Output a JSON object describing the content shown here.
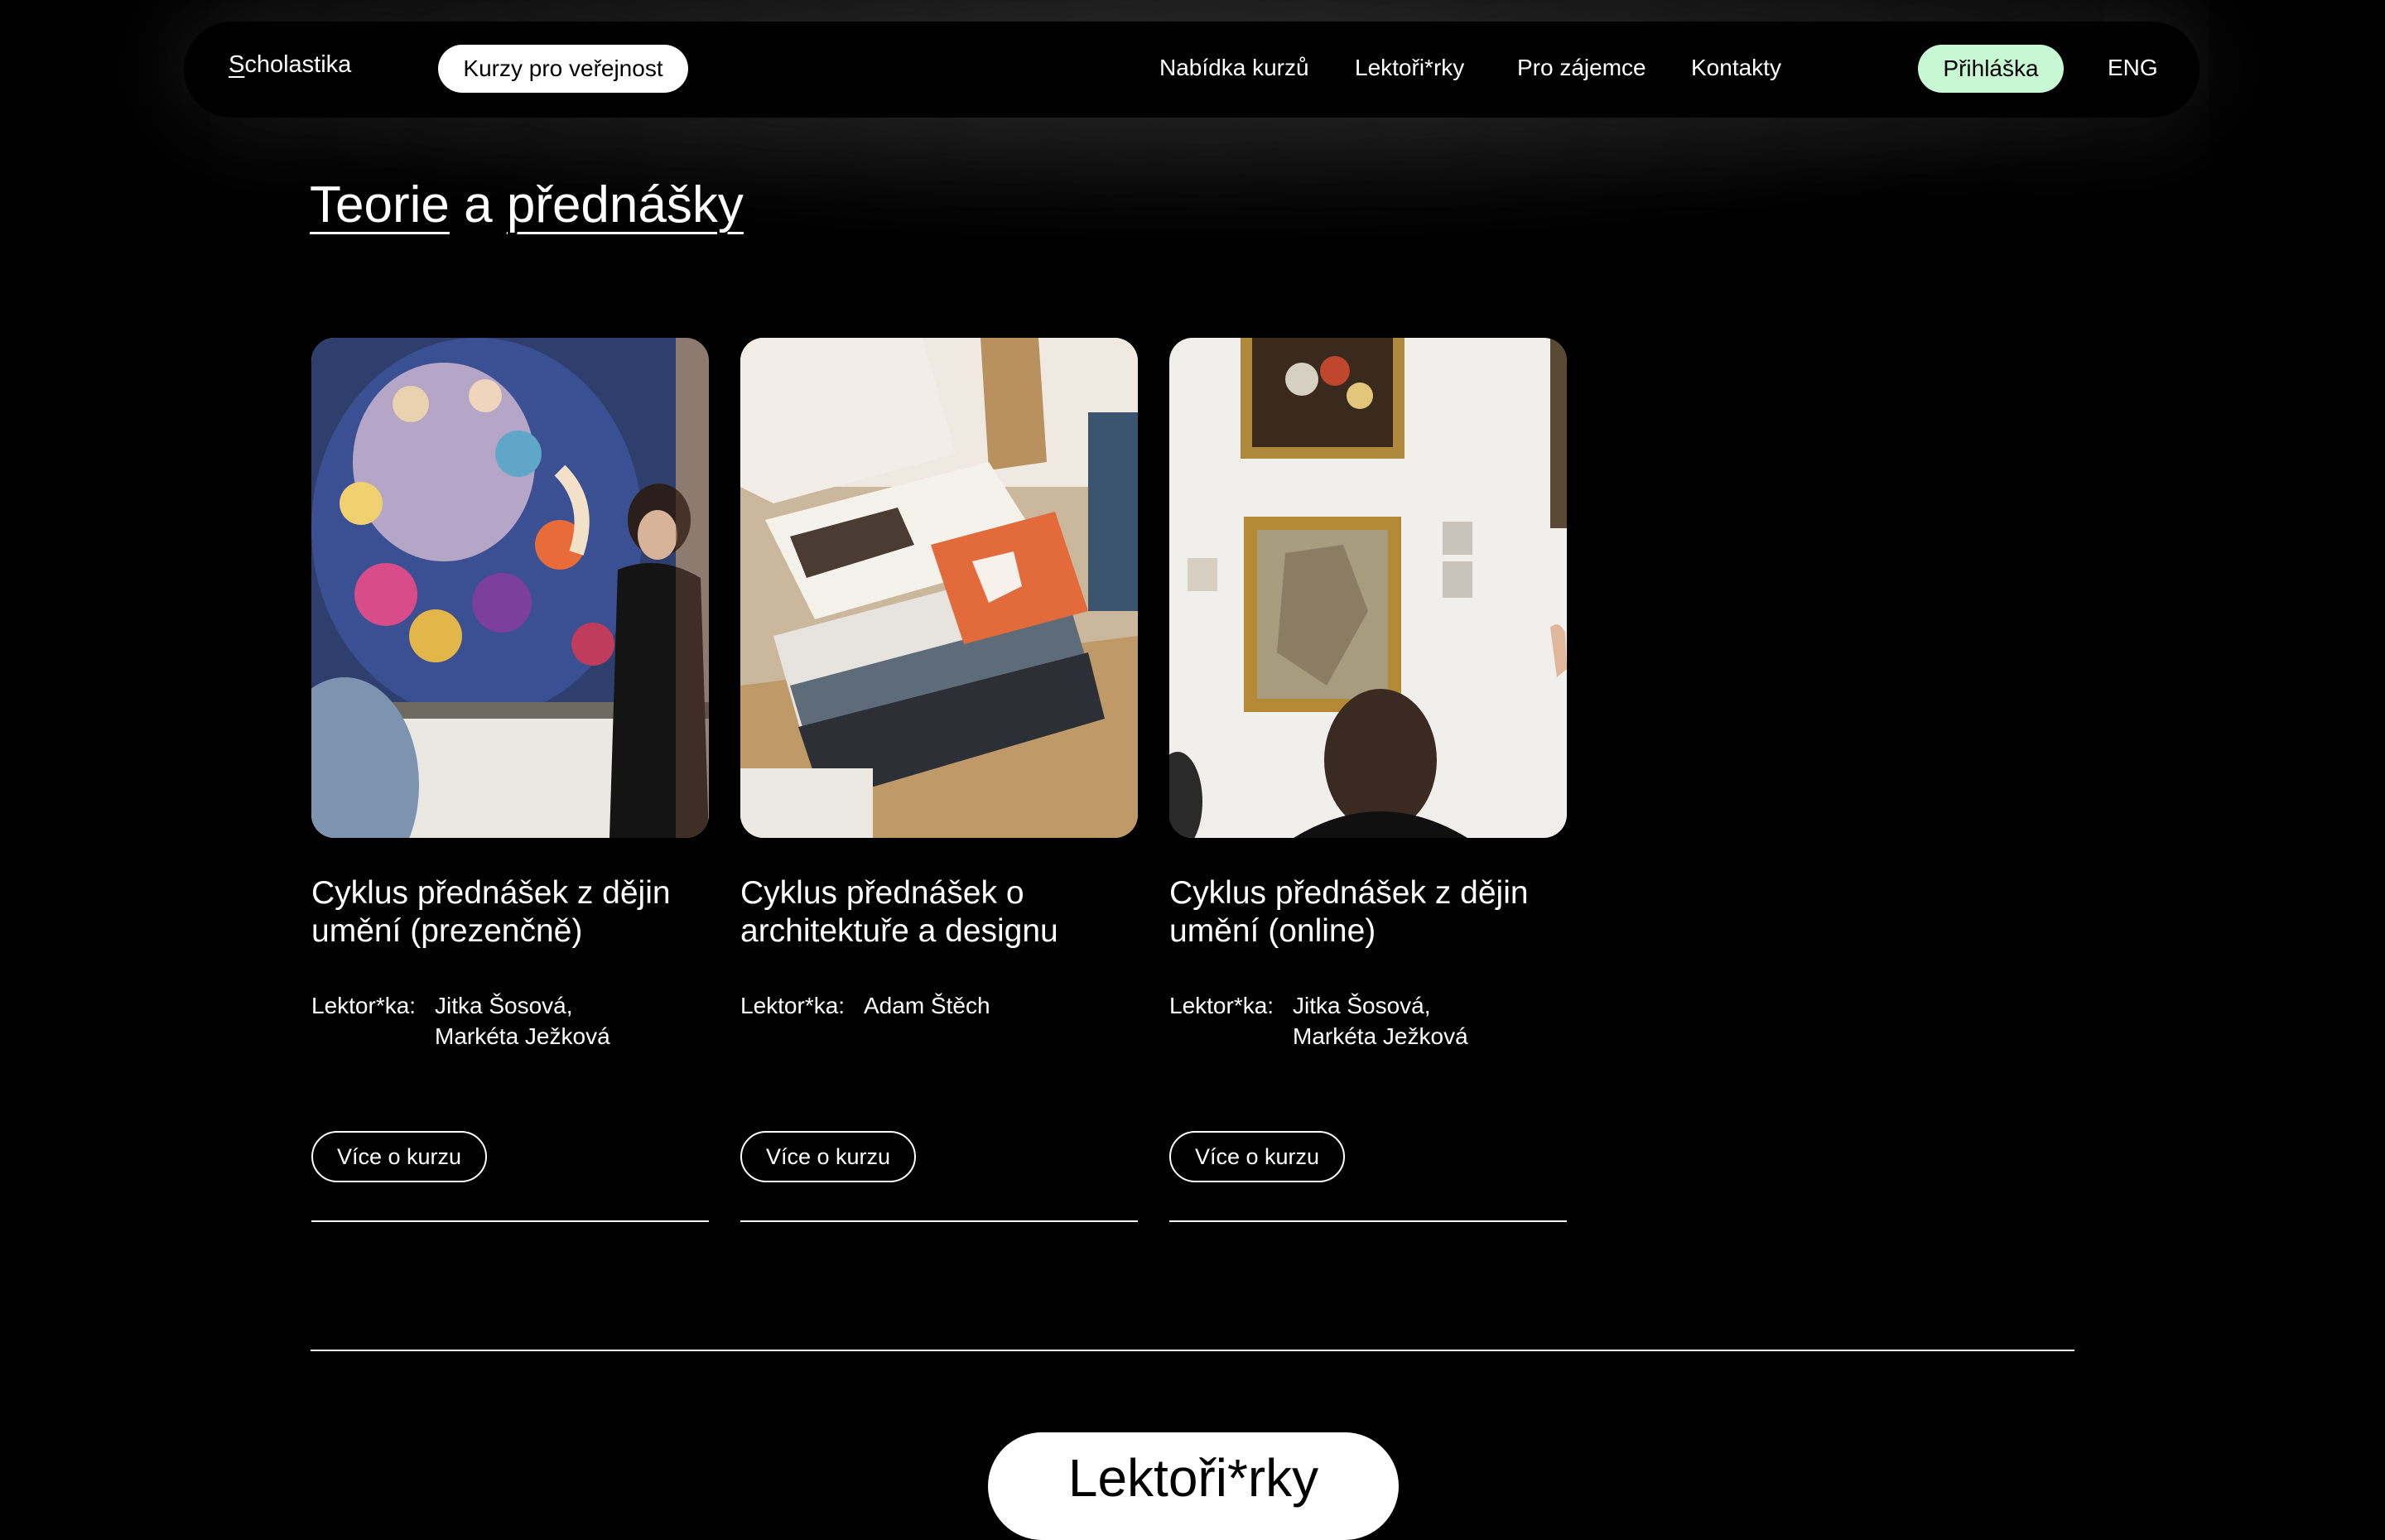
{
  "nav": {
    "brand_initial": "S",
    "brand_rest": "cholastika",
    "public_courses": "Kurzy pro veřejnost",
    "menu": [
      "Nabídka kurzů",
      "Lektoři*rky",
      "Pro zájemce",
      "Kontakty"
    ],
    "apply": "Přihláška",
    "lang": "ENG"
  },
  "section": {
    "title_word1": "Teorie",
    "title_mid": " a ",
    "title_word2": "přednášky"
  },
  "cards": [
    {
      "title": "Cyklus přednášek z dějin umění (prezenčně)",
      "lector_label": "Lektor*ka:",
      "lectors": [
        "Jitka Šosová,",
        "Markéta Ježková"
      ],
      "button": "Více o kurzu",
      "image": "gallery-painting-klimt-lecture"
    },
    {
      "title": "Cyklus přednášek o architektuře a designu",
      "lector_label": "Lektor*ka:",
      "lectors": [
        "Adam Štěch"
      ],
      "button": "Více o kurzu",
      "image": "stack-of-design-books"
    },
    {
      "title": "Cyklus přednášek z dějin umění (online)",
      "lector_label": "Lektor*ka:",
      "lectors": [
        "Jitka Šosová,",
        "Markéta Ježková"
      ],
      "button": "Více o kurzu",
      "image": "gallery-wall-framed-paintings"
    }
  ],
  "next_section": "Lektoři*rky",
  "colors": {
    "background": "#000000",
    "accent_apply": "#c8f7d4",
    "pill": "#ffffff"
  }
}
